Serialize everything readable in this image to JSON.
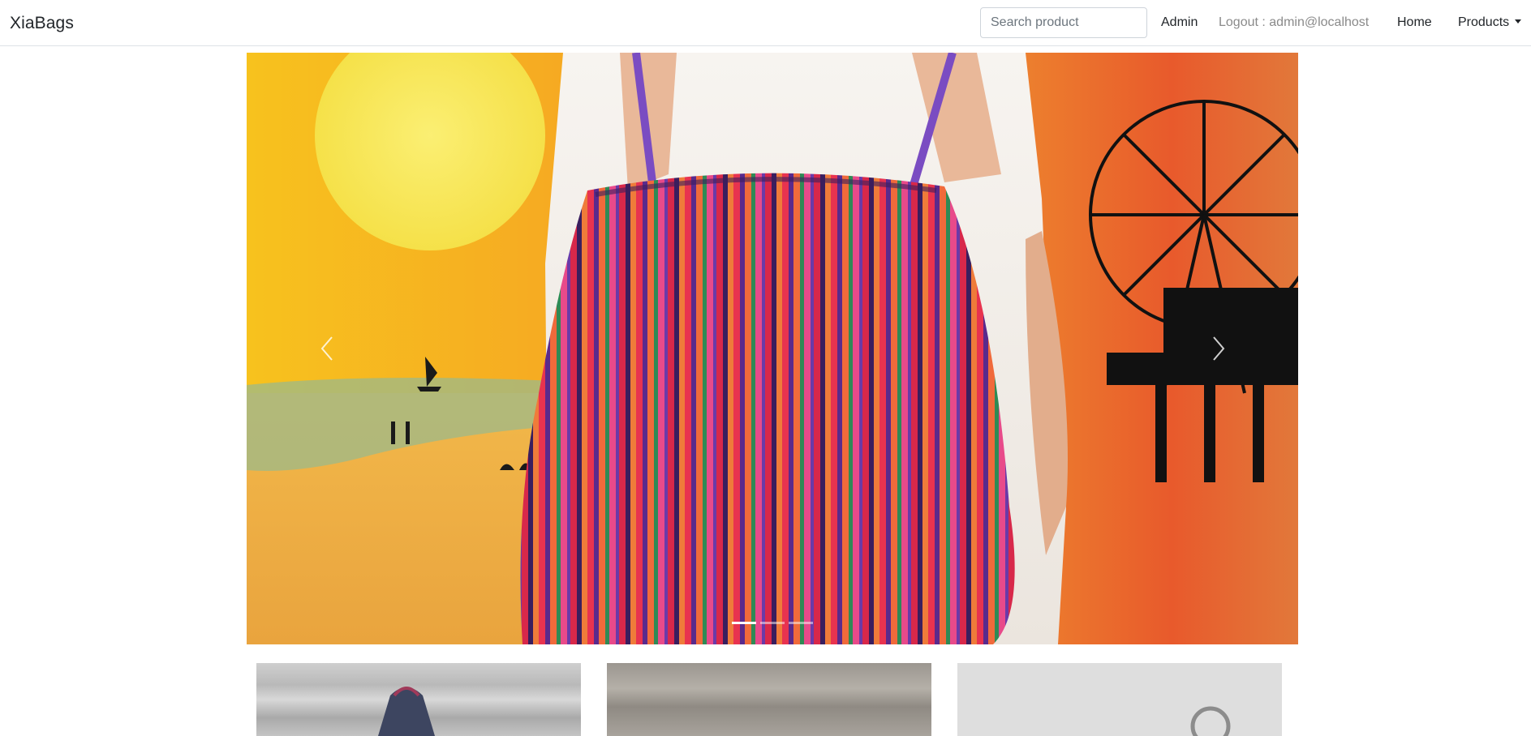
{
  "navbar": {
    "brand": "XiaBags",
    "search": {
      "placeholder": "Search product",
      "value": ""
    },
    "links": {
      "admin": "Admin",
      "logout": "Logout : admin@localhost",
      "home": "Home",
      "products": "Products"
    }
  },
  "carousel": {
    "slide_count": 3,
    "active_slide": 1,
    "prev_icon": "chevron-left-icon",
    "next_icon": "chevron-right-icon"
  },
  "cards": [
    {
      "name": "product-card-1"
    },
    {
      "name": "product-card-2"
    },
    {
      "name": "product-card-3"
    }
  ]
}
